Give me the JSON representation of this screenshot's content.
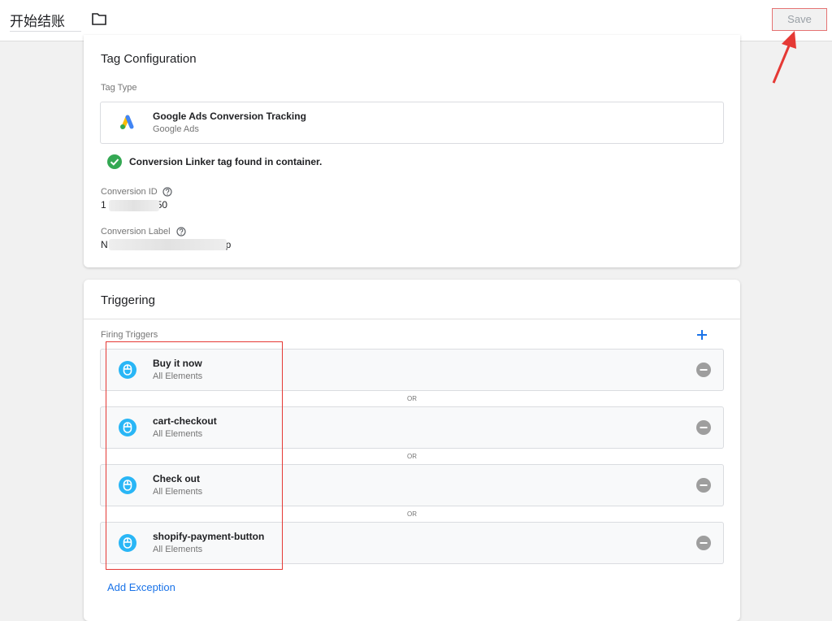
{
  "header": {
    "tag_name": "开始结账",
    "save_label": "Save"
  },
  "tag_configuration": {
    "title": "Tag Configuration",
    "tag_type_label": "Tag Type",
    "tag_type_name": "Google Ads Conversion Tracking",
    "tag_type_vendor": "Google Ads",
    "linker_message": "Conversion Linker tag found in container.",
    "conversion_id_label": "Conversion ID",
    "conversion_id_value_start": "1",
    "conversion_id_value_end": "50",
    "conversion_label_label": "Conversion Label",
    "conversion_label_value_start": "N",
    "conversion_label_value_end": "p"
  },
  "triggering": {
    "title": "Triggering",
    "firing_label": "Firing Triggers",
    "or_label": "OR",
    "triggers": [
      {
        "name": "Buy it now",
        "type": "All Elements"
      },
      {
        "name": "cart-checkout",
        "type": "All Elements"
      },
      {
        "name": "Check out",
        "type": "All Elements"
      },
      {
        "name": "shopify-payment-button",
        "type": "All Elements"
      }
    ],
    "add_exception_label": "Add Exception"
  },
  "colors": {
    "accent_blue": "#1a73e8",
    "success_green": "#34a853",
    "trigger_icon_blue": "#29b6f6",
    "highlight_red": "#e53935"
  },
  "icons": [
    "folder-icon",
    "google-ads-icon",
    "check-circle-icon",
    "help-icon",
    "plus-icon",
    "click-icon",
    "remove-icon"
  ]
}
